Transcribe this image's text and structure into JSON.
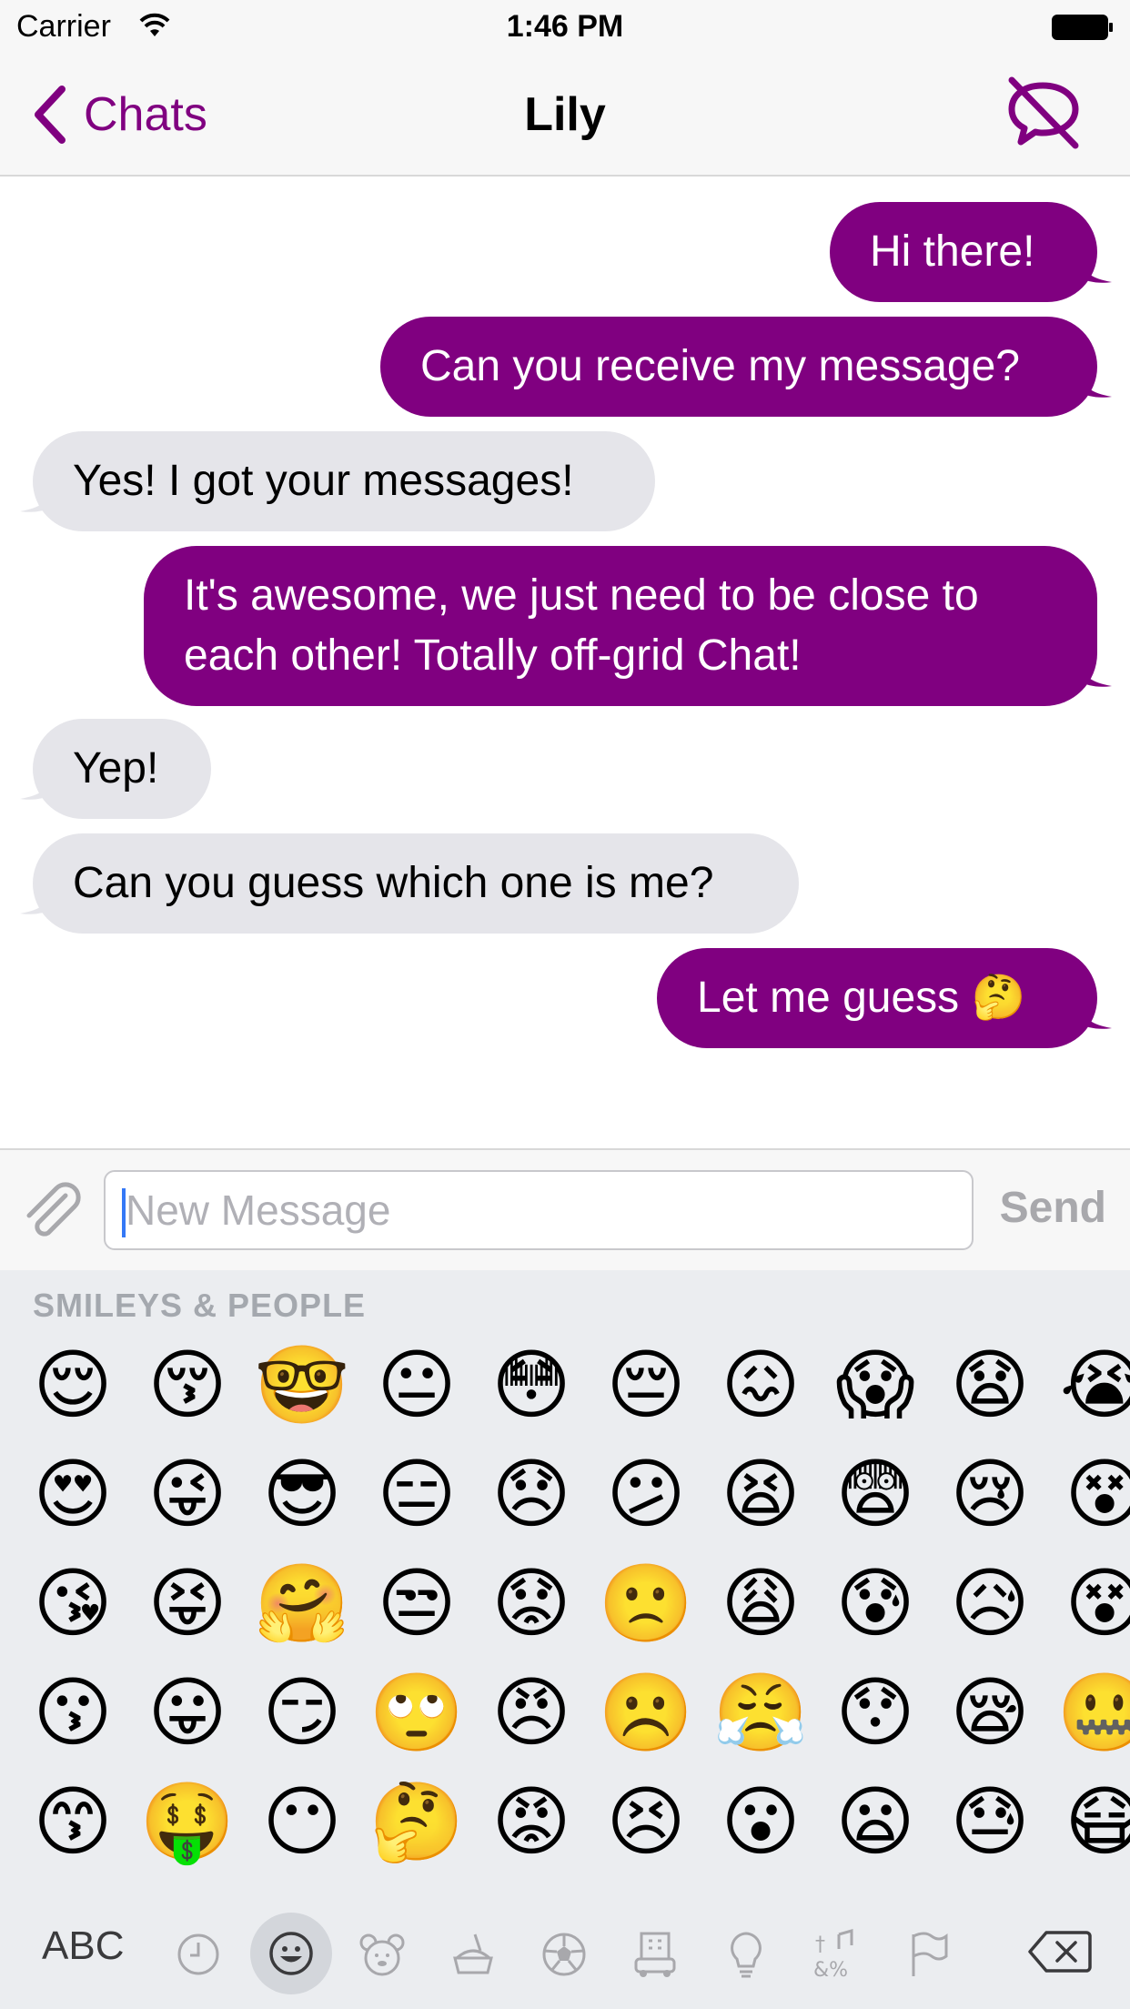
{
  "status_bar": {
    "carrier": "Carrier",
    "time": "1:46 PM"
  },
  "nav": {
    "back_label": "Chats",
    "title": "Lily",
    "right_icon": "offline-chat-icon",
    "accent": "#800080"
  },
  "messages": [
    {
      "side": "out",
      "text": "Hi there!"
    },
    {
      "side": "out",
      "text": "Can you receive my message?"
    },
    {
      "side": "in",
      "text": "Yes! I got your messages!"
    },
    {
      "side": "out",
      "text": "It's awesome, we just need to be close to each other! Totally off-grid Chat!"
    },
    {
      "side": "in",
      "text": "Yep!"
    },
    {
      "side": "in",
      "text": "Can you guess which one is me?"
    },
    {
      "side": "out",
      "text": "Let me guess 🤔"
    }
  ],
  "composer": {
    "placeholder": "New Message",
    "value": "",
    "send_label": "Send",
    "attach_icon": "paperclip-icon"
  },
  "keyboard": {
    "section_title": "SMILEYS & PEOPLE",
    "emoji_rows": [
      [
        "😌",
        "😚",
        "🤓",
        "😐",
        "😳",
        "😔",
        "😖",
        "😱",
        "😧",
        "😭"
      ],
      [
        "😍",
        "😜",
        "😎",
        "😑",
        "😞",
        "😕",
        "😫",
        "😨",
        "😢",
        "😵"
      ],
      [
        "😘",
        "😝",
        "🤗",
        "😒",
        "😟",
        "🙁",
        "😩",
        "😰",
        "😥",
        "😵"
      ],
      [
        "😗",
        "😛",
        "😏",
        "🙄",
        "😠",
        "☹️",
        "😤",
        "😯",
        "😪",
        "🤐"
      ],
      [
        "😙",
        "🤑",
        "😶",
        "🤔",
        "😡",
        "😣",
        "😮",
        "😦",
        "😓",
        "😷"
      ]
    ],
    "abc_label": "ABC",
    "categories": [
      "recent-icon",
      "smileys-icon",
      "animals-icon",
      "food-icon",
      "activity-icon",
      "travel-icon",
      "objects-icon",
      "symbols-icon",
      "flags-icon"
    ],
    "selected_category": "smileys-icon",
    "delete_icon": "backspace-icon"
  }
}
